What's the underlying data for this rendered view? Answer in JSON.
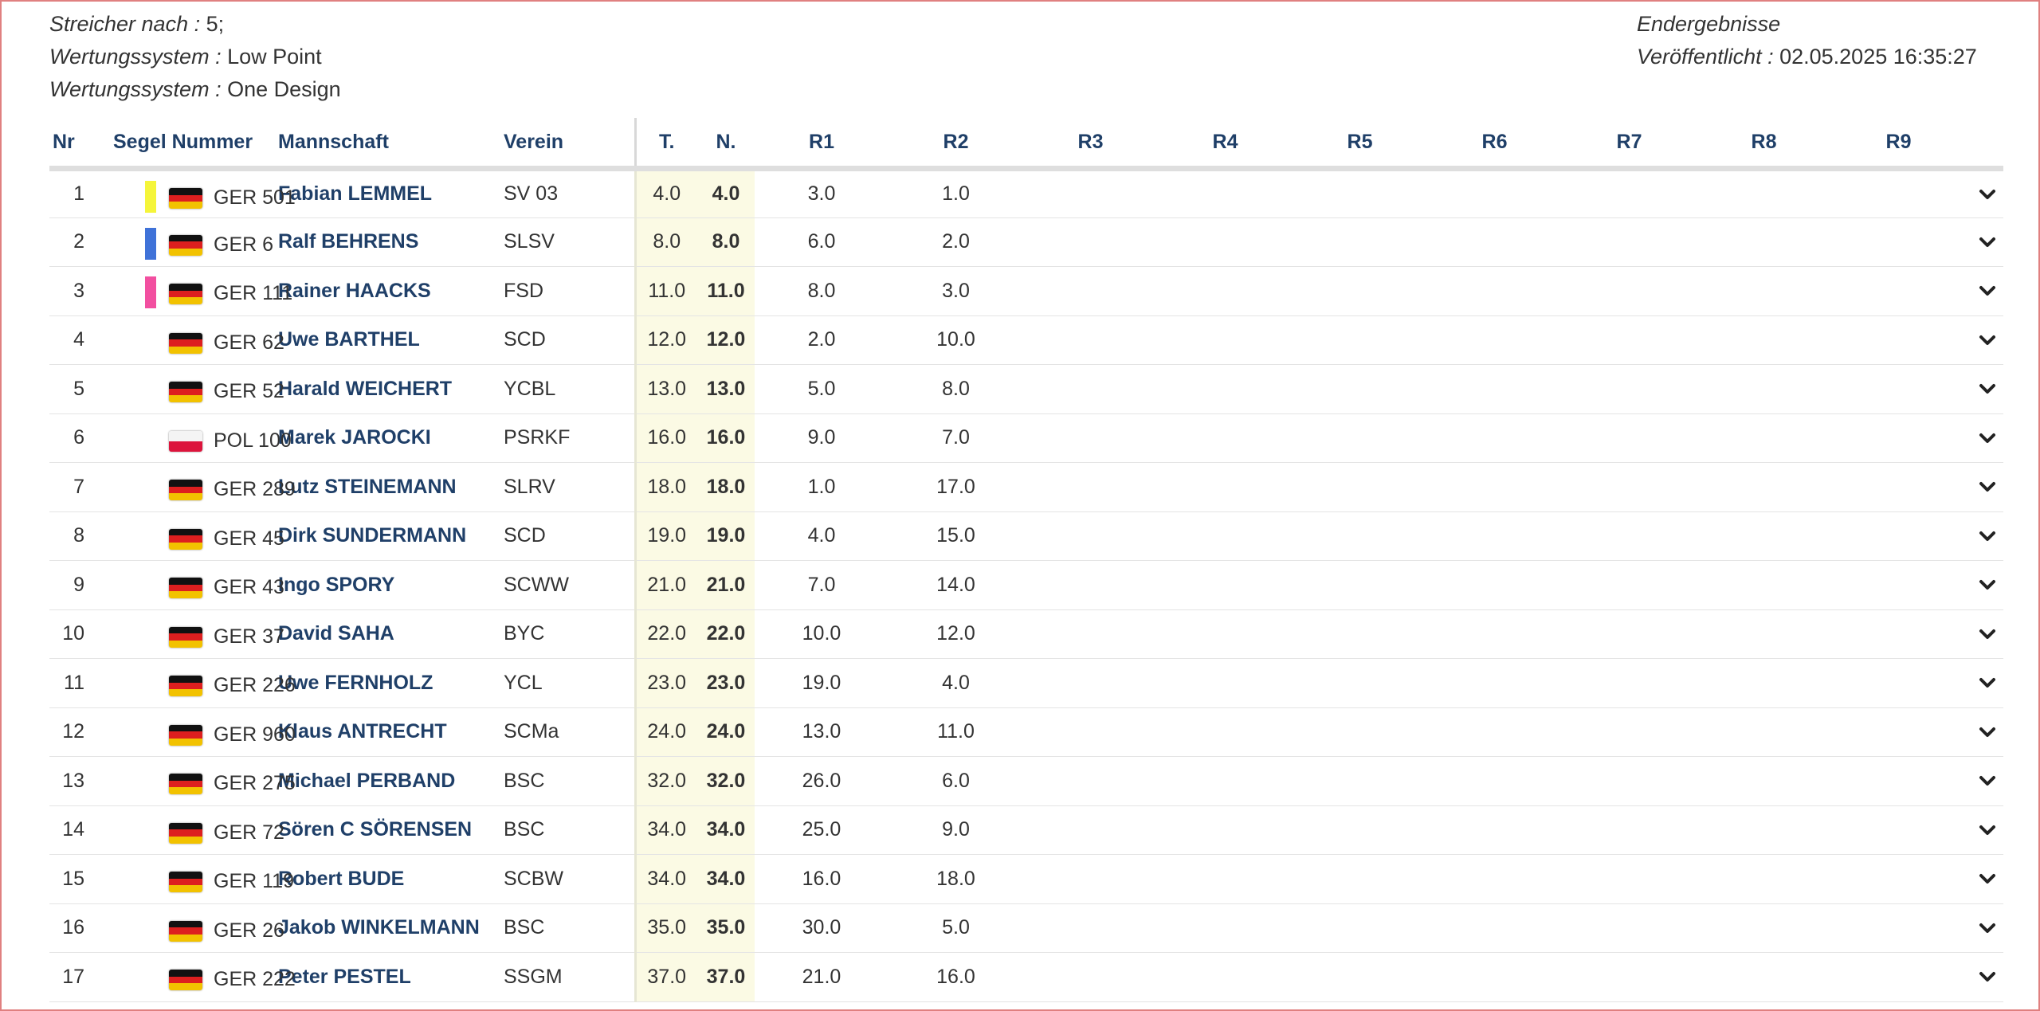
{
  "header": {
    "left": [
      {
        "key": "Streicher nach :",
        "value": " 5;"
      },
      {
        "key": "Wertungssystem :",
        "value": " Low Point"
      },
      {
        "key": "Wertungssystem :",
        "value": " One Design"
      }
    ],
    "right": [
      {
        "key": "Endergebnisse",
        "value": ""
      },
      {
        "key": "Veröffentlicht :",
        "value": " 02.05.2025 16:35:27"
      }
    ]
  },
  "table": {
    "columns": {
      "nr": "Nr",
      "segel": "Segel Nummer",
      "team": "Mannschaft",
      "club": "Verein",
      "total": "T.",
      "net": "N.",
      "races": [
        "R1",
        "R2",
        "R3",
        "R4",
        "R5",
        "R6",
        "R7",
        "R8",
        "R9"
      ]
    },
    "rows": [
      {
        "nr": "1",
        "medal": "#f5f53a",
        "flag": "GER",
        "sail": "GER 501",
        "team": "Fabian LEMMEL",
        "club": "SV 03",
        "total": "4.0",
        "net": "4.0",
        "races": [
          "3.0",
          "1.0"
        ]
      },
      {
        "nr": "2",
        "medal": "#3f72d8",
        "flag": "GER",
        "sail": "GER 6",
        "team": "Ralf BEHRENS",
        "club": "SLSV",
        "total": "8.0",
        "net": "8.0",
        "races": [
          "6.0",
          "2.0"
        ]
      },
      {
        "nr": "3",
        "medal": "#f24fa0",
        "flag": "GER",
        "sail": "GER 111",
        "team": "Rainer HAACKS",
        "club": "FSD",
        "total": "11.0",
        "net": "11.0",
        "races": [
          "8.0",
          "3.0"
        ]
      },
      {
        "nr": "4",
        "medal": "",
        "flag": "GER",
        "sail": "GER 62",
        "team": "Uwe BARTHEL",
        "club": "SCD",
        "total": "12.0",
        "net": "12.0",
        "races": [
          "2.0",
          "10.0"
        ]
      },
      {
        "nr": "5",
        "medal": "",
        "flag": "GER",
        "sail": "GER 52",
        "team": "Harald WEICHERT",
        "club": "YCBL",
        "total": "13.0",
        "net": "13.0",
        "races": [
          "5.0",
          "8.0"
        ]
      },
      {
        "nr": "6",
        "medal": "",
        "flag": "POL",
        "sail": "POL 100",
        "team": "Marek JAROCKI",
        "club": "PSRKF",
        "total": "16.0",
        "net": "16.0",
        "races": [
          "9.0",
          "7.0"
        ]
      },
      {
        "nr": "7",
        "medal": "",
        "flag": "GER",
        "sail": "GER 289",
        "team": "Lutz STEINEMANN",
        "club": "SLRV",
        "total": "18.0",
        "net": "18.0",
        "races": [
          "1.0",
          "17.0"
        ]
      },
      {
        "nr": "8",
        "medal": "",
        "flag": "GER",
        "sail": "GER 45",
        "team": "Dirk SUNDERMANN",
        "club": "SCD",
        "total": "19.0",
        "net": "19.0",
        "races": [
          "4.0",
          "15.0"
        ]
      },
      {
        "nr": "9",
        "medal": "",
        "flag": "GER",
        "sail": "GER 43",
        "team": "Ingo SPORY",
        "club": "SCWW",
        "total": "21.0",
        "net": "21.0",
        "races": [
          "7.0",
          "14.0"
        ]
      },
      {
        "nr": "10",
        "medal": "",
        "flag": "GER",
        "sail": "GER 37",
        "team": "David SAHA",
        "club": "BYC",
        "total": "22.0",
        "net": "22.0",
        "races": [
          "10.0",
          "12.0"
        ]
      },
      {
        "nr": "11",
        "medal": "",
        "flag": "GER",
        "sail": "GER 226",
        "team": "Uwe FERNHOLZ",
        "club": "YCL",
        "total": "23.0",
        "net": "23.0",
        "races": [
          "19.0",
          "4.0"
        ]
      },
      {
        "nr": "12",
        "medal": "",
        "flag": "GER",
        "sail": "GER 960",
        "team": "Klaus ANTRECHT",
        "club": "SCMa",
        "total": "24.0",
        "net": "24.0",
        "races": [
          "13.0",
          "11.0"
        ]
      },
      {
        "nr": "13",
        "medal": "",
        "flag": "GER",
        "sail": "GER 275",
        "team": "Michael PERBAND",
        "club": "BSC",
        "total": "32.0",
        "net": "32.0",
        "races": [
          "26.0",
          "6.0"
        ]
      },
      {
        "nr": "14",
        "medal": "",
        "flag": "GER",
        "sail": "GER 72",
        "team": "Sören C SÖRENSEN",
        "club": "BSC",
        "total": "34.0",
        "net": "34.0",
        "races": [
          "25.0",
          "9.0"
        ]
      },
      {
        "nr": "15",
        "medal": "",
        "flag": "GER",
        "sail": "GER 119",
        "team": "Robert BUDE",
        "club": "SCBW",
        "total": "34.0",
        "net": "34.0",
        "races": [
          "16.0",
          "18.0"
        ]
      },
      {
        "nr": "16",
        "medal": "",
        "flag": "GER",
        "sail": "GER 26",
        "team": "Jakob WINKELMANN",
        "club": "BSC",
        "total": "35.0",
        "net": "35.0",
        "races": [
          "30.0",
          "5.0"
        ]
      },
      {
        "nr": "17",
        "medal": "",
        "flag": "GER",
        "sail": "GER 222",
        "team": "Peter PESTEL",
        "club": "SSGM",
        "total": "37.0",
        "net": "37.0",
        "races": [
          "21.0",
          "16.0"
        ]
      }
    ]
  },
  "flags": {
    "GER": [
      "#111111",
      "#dd1f1f",
      "#f2c200"
    ],
    "POL": [
      "#f4f4f4",
      "#dc143c"
    ]
  },
  "icons": {
    "row_expand": "chevron-down-icon"
  }
}
